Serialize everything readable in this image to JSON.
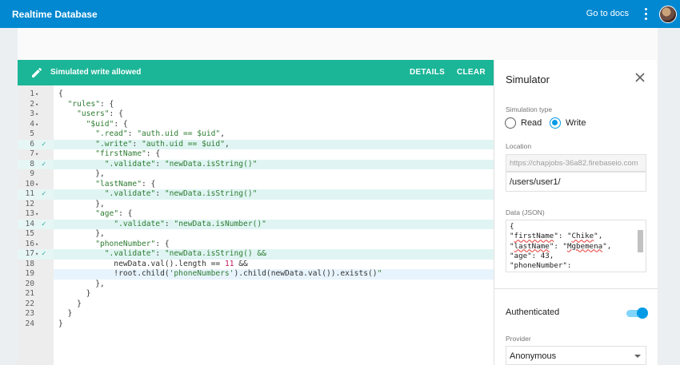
{
  "app": {
    "title": "Realtime Database",
    "docs_link": "Go to docs"
  },
  "banner": {
    "message": "Simulated write allowed",
    "details": "DETAILS",
    "clear": "CLEAR"
  },
  "editor": {
    "lines": [
      {
        "num": "1",
        "fold": true,
        "check": false,
        "code": "{"
      },
      {
        "num": "2",
        "fold": true,
        "check": false,
        "code": "  \"rules\": {"
      },
      {
        "num": "3",
        "fold": true,
        "check": false,
        "code": "    \"users\": {"
      },
      {
        "num": "4",
        "fold": true,
        "check": false,
        "code": "      \"$uid\": {"
      },
      {
        "num": "5",
        "fold": false,
        "check": false,
        "code": "        \".read\": \"auth.uid == $uid\","
      },
      {
        "num": "6",
        "fold": false,
        "check": true,
        "code": "        \".write\": \"auth.uid == $uid\","
      },
      {
        "num": "7",
        "fold": true,
        "check": false,
        "code": "        \"firstName\": {"
      },
      {
        "num": "8",
        "fold": false,
        "check": true,
        "code": "          \".validate\": \"newData.isString()\""
      },
      {
        "num": "9",
        "fold": false,
        "check": false,
        "code": "        },"
      },
      {
        "num": "10",
        "fold": true,
        "check": false,
        "code": "        \"lastName\": {"
      },
      {
        "num": "11",
        "fold": false,
        "check": true,
        "code": "          \".validate\": \"newData.isString()\""
      },
      {
        "num": "12",
        "fold": false,
        "check": false,
        "code": "        },"
      },
      {
        "num": "13",
        "fold": true,
        "check": false,
        "code": "        \"age\": {"
      },
      {
        "num": "14",
        "fold": false,
        "check": true,
        "code": "            \".validate\": \"newData.isNumber()\""
      },
      {
        "num": "15",
        "fold": false,
        "check": false,
        "code": "        },"
      },
      {
        "num": "16",
        "fold": true,
        "check": false,
        "code": "        \"phoneNumber\": {"
      },
      {
        "num": "17",
        "fold": true,
        "check": true,
        "code": "          \".validate\": \"newData.isString() &&"
      },
      {
        "num": "18",
        "fold": false,
        "check": false,
        "code": "            newData.val().length == 11 &&"
      },
      {
        "num": "19",
        "fold": false,
        "check": false,
        "code": "            !root.child('phoneNumbers').child(newData.val()).exists()\""
      },
      {
        "num": "20",
        "fold": false,
        "check": false,
        "code": "        },"
      },
      {
        "num": "21",
        "fold": false,
        "check": false,
        "code": "      }"
      },
      {
        "num": "22",
        "fold": false,
        "check": false,
        "code": "    }"
      },
      {
        "num": "23",
        "fold": false,
        "check": false,
        "code": "  }"
      },
      {
        "num": "24",
        "fold": false,
        "check": false,
        "code": "}"
      }
    ]
  },
  "simulator": {
    "title": "Simulator",
    "sim_type_label": "Simulation type",
    "read_label": "Read",
    "write_label": "Write",
    "selected": "Write",
    "location_label": "Location",
    "location_prefix": "https://chapjobs-36a82.firebaseio.com",
    "location_path": "/users/user1/",
    "data_label": "Data (JSON)",
    "json_lines": [
      "{",
      "\"firstName\": \"Chike\",",
      "\"lastName\": \"Mgbemena\",",
      "\"age\": 43,",
      "\"phoneNumber\":"
    ],
    "auth_label": "Authenticated",
    "auth_on": true,
    "provider_label": "Provider",
    "provider_value": "Anonymous"
  },
  "colors": {
    "topbar": "#0288d1",
    "banner": "#1bb597",
    "accent": "#039be5"
  }
}
